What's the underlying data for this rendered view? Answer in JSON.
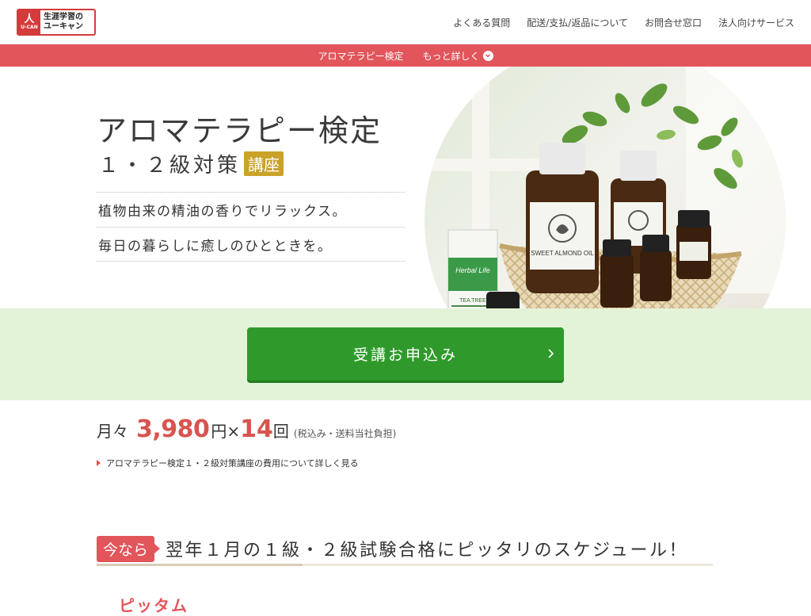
{
  "header": {
    "logo": {
      "line1": "生涯学習の",
      "line2": "ユーキャン",
      "mark": "U-CAN"
    },
    "nav": [
      "よくある質問",
      "配送/支払/返品について",
      "お問合せ窓口",
      "法人向けサービス"
    ]
  },
  "subbar": {
    "title": "アロマテラピー検定",
    "more": "もっと詳しく"
  },
  "hero": {
    "title": "アロマテラピー検定",
    "subtitle": "１・２級対策",
    "badge": "講座",
    "lines": [
      "植物由来の精油の香りでリラックス。",
      "毎日の暮らしに癒しのひとときを。"
    ],
    "photo_labels": {
      "bottle_big": "SWEET ALMOND OIL",
      "box_brand": "Herbal Life",
      "box_name": "TEA TREE"
    }
  },
  "cta": {
    "label": "受講お申込み"
  },
  "price": {
    "lead": "月々",
    "amount": "3,980",
    "unit": "円×",
    "count": "14",
    "count_unit": "回",
    "note": "(税込み・送料当社負担)",
    "link": "アロマテラピー検定１・２級対策講座の費用について詳しく見る"
  },
  "now": {
    "badge": "今なら",
    "title": "翌年１月の１級・２級試験合格にピッタリのスケジュール！",
    "peek": "ピッタム"
  },
  "colors": {
    "accent_red": "#e2555b",
    "cta_green": "#2f9a2b",
    "band_green": "#e3f3d8",
    "badge_gold": "#c9a227"
  }
}
